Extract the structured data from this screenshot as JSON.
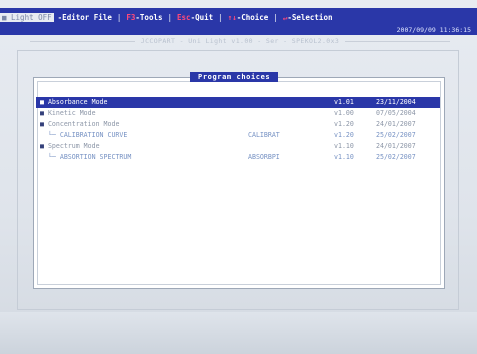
{
  "menu": {
    "light_off": "■ Light OFF",
    "editor_file": "-Editor File",
    "tools_key": "F3",
    "tools_label": "-Tools",
    "quit_key": "Esc",
    "quit_label": "-Quit",
    "choice_key": "↑↓",
    "choice_label": "-Choice",
    "selection_key": "↵",
    "selection_label": "-Selection"
  },
  "status": {
    "datetime": "2007/09/09 11:36:15"
  },
  "title_line": "JCCOPART - Uni Light v1.00 - Ser - SPEKOL2.0x3",
  "dialog": {
    "title": "Program choices",
    "rows": [
      {
        "name": "Absorbance Mode",
        "tag": "",
        "version": "v1.01",
        "date": "23/11/2004",
        "selected": true,
        "sub": false
      },
      {
        "name": "Kinetic Mode",
        "tag": "",
        "version": "v1.00",
        "date": "07/05/2004",
        "selected": false,
        "sub": false
      },
      {
        "name": "Concentration Mode",
        "tag": "",
        "version": "v1.20",
        "date": "24/01/2007",
        "selected": false,
        "sub": false
      },
      {
        "name": "CALIBRATION CURVE",
        "tag": "CALIBRAT",
        "version": "v1.20",
        "date": "25/02/2007",
        "selected": false,
        "sub": true
      },
      {
        "name": "Spectrum Mode",
        "tag": "",
        "version": "v1.10",
        "date": "24/01/2007",
        "selected": false,
        "sub": false
      },
      {
        "name": "ABSORTION SPECTRUM",
        "tag": "ABSORBPI",
        "version": "v1.10",
        "date": "25/02/2007",
        "selected": false,
        "sub": true
      }
    ]
  }
}
